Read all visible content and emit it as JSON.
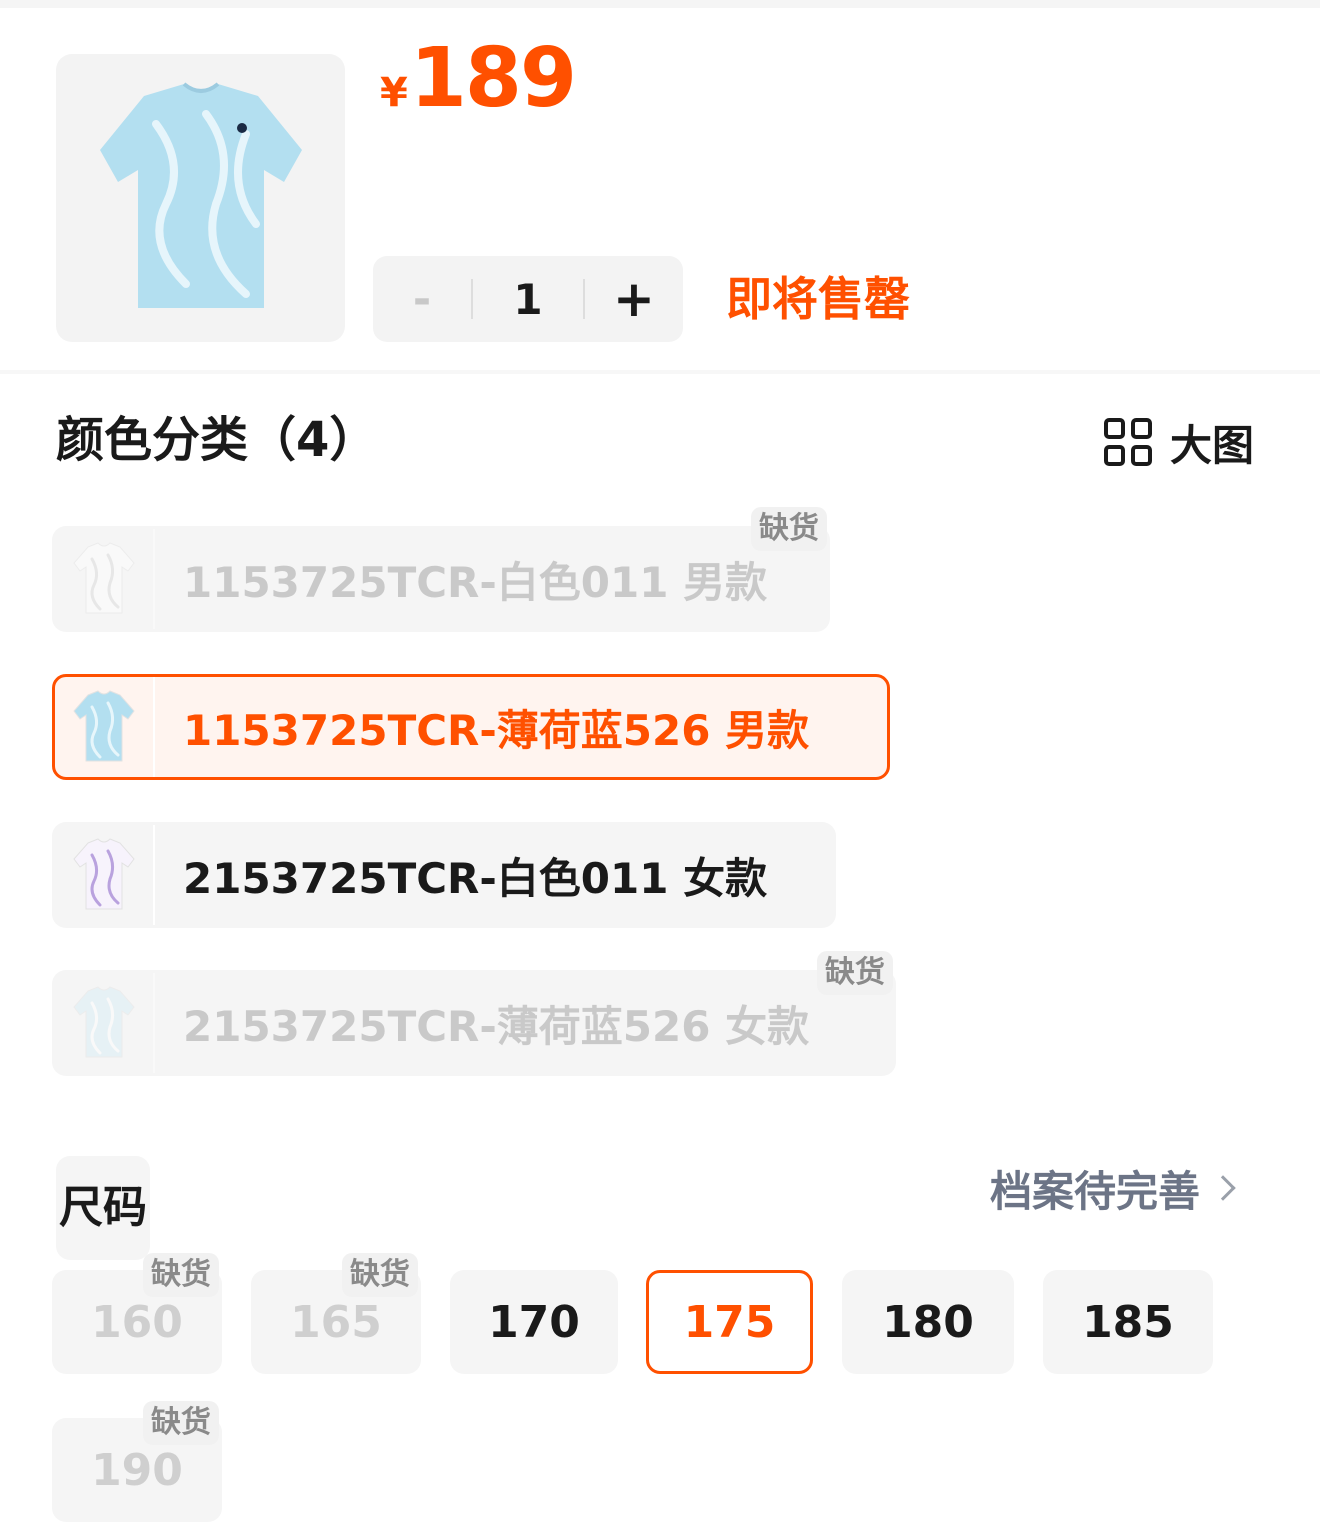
{
  "product": {
    "currency": "¥",
    "price": "189",
    "quantity": "1",
    "stepper_minus": "-",
    "stepper_plus": "+",
    "stock_notice": "即将售罄"
  },
  "color_section": {
    "title": "颜色分类（4）",
    "big_view_label": "大图",
    "options": [
      {
        "label": "1153725TCR-白色011 男款",
        "state": "out_of_stock",
        "badge": "缺货",
        "swatch": "#ffffff",
        "pattern": "#d8d8d8"
      },
      {
        "label": "1153725TCR-薄荷蓝526 男款",
        "state": "selected",
        "badge": "",
        "swatch": "#b3dff0",
        "pattern": "#e7f6fb"
      },
      {
        "label": "2153725TCR-白色011 女款",
        "state": "available",
        "badge": "",
        "swatch": "#f7f3fc",
        "pattern": "#b9a2de"
      },
      {
        "label": "2153725TCR-薄荷蓝526 女款",
        "state": "out_of_stock",
        "badge": "缺货",
        "swatch": "#d6eef7",
        "pattern": "#ffffff"
      }
    ]
  },
  "size_section": {
    "title": "尺码",
    "profile_link": "档案待完善",
    "sizes": [
      {
        "label": "160",
        "state": "out_of_stock",
        "badge": "缺货"
      },
      {
        "label": "165",
        "state": "out_of_stock",
        "badge": "缺货"
      },
      {
        "label": "170",
        "state": "available",
        "badge": ""
      },
      {
        "label": "175",
        "state": "selected",
        "badge": ""
      },
      {
        "label": "180",
        "state": "available",
        "badge": ""
      },
      {
        "label": "185",
        "state": "available",
        "badge": ""
      },
      {
        "label": "190",
        "state": "out_of_stock",
        "badge": "缺货"
      }
    ]
  },
  "colors": {
    "accent": "#ff5000",
    "muted": "#c9c9c9",
    "chip_bg": "#f5f5f5"
  }
}
